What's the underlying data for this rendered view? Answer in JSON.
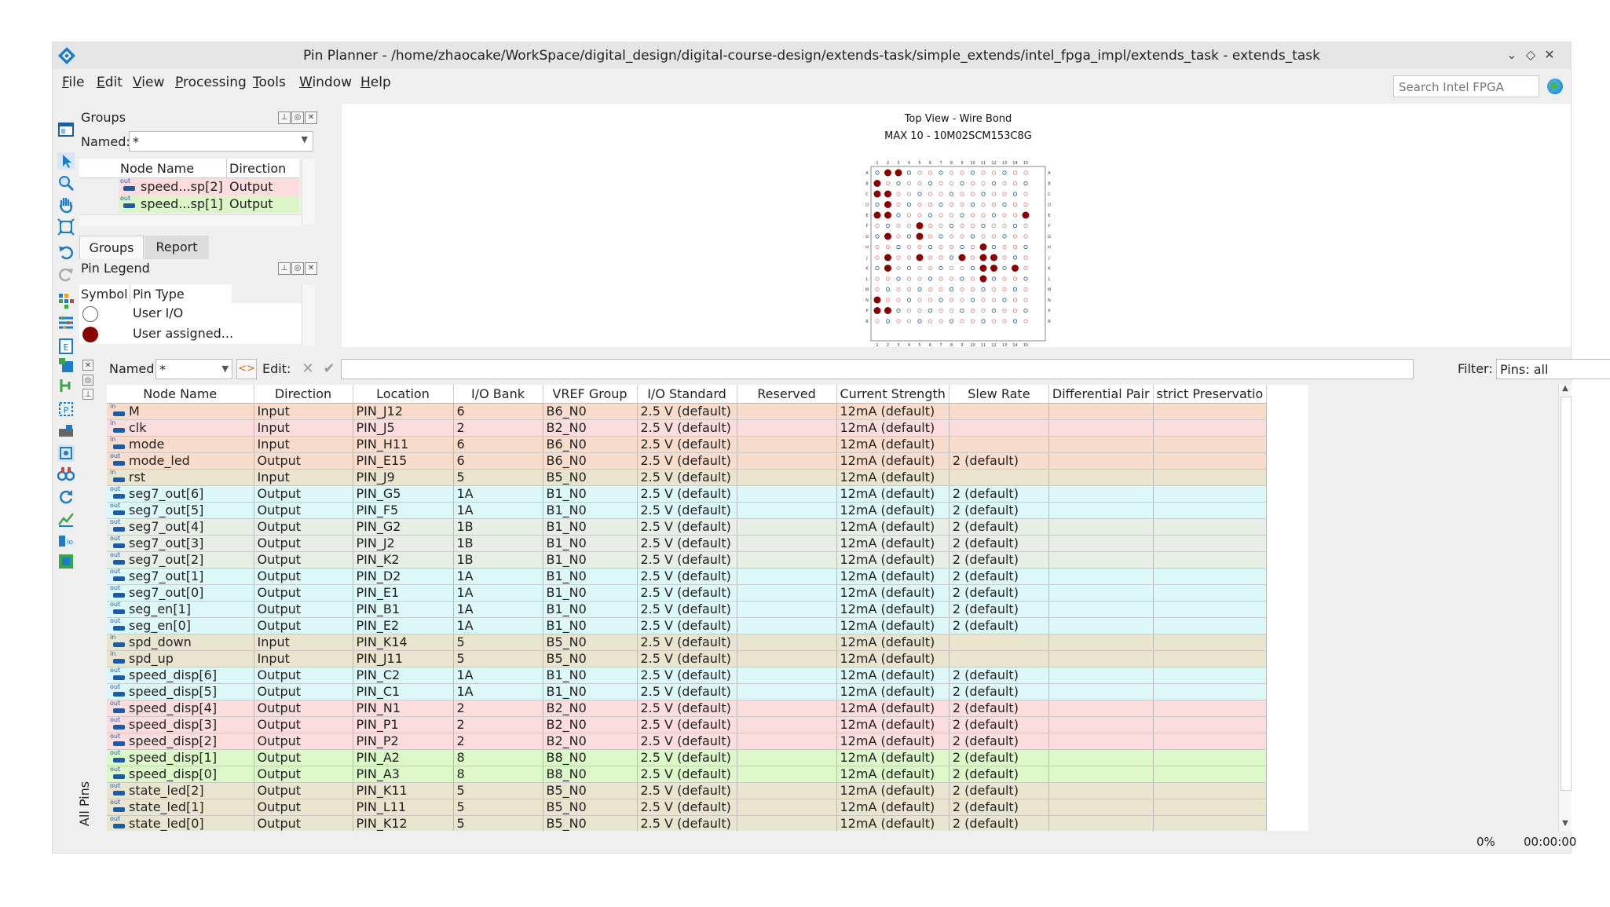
{
  "window": {
    "title": "Pin Planner - /home/zhaocake/WorkSpace/digital_design/digital-course-design/extends-task/simple_extends/intel_fpga_impl/extends_task - extends_task",
    "controls": [
      "⌄",
      "◇",
      "✕"
    ]
  },
  "menu": {
    "items": [
      {
        "label": "File",
        "key": "F",
        "rest": "ile"
      },
      {
        "label": "Edit",
        "key": "E",
        "rest": "dit"
      },
      {
        "label": "View",
        "key": "V",
        "rest": "iew"
      },
      {
        "label": "Processing",
        "key": "P",
        "rest": "rocessing"
      },
      {
        "label": "Tools",
        "key": "T",
        "rest": "ools"
      },
      {
        "label": "Window",
        "key": "W",
        "rest": "indow"
      },
      {
        "label": "Help",
        "key": "H",
        "rest": "elp"
      }
    ]
  },
  "search": {
    "placeholder": "Search Intel FPGA"
  },
  "groups_panel": {
    "title": "Groups",
    "named_label": "Named:",
    "named_value": "*",
    "columns": [
      "Node Name",
      "Direction"
    ],
    "rows": [
      {
        "name": "speed...sp[2]",
        "direction": "Output",
        "color": "#fcdcdc"
      },
      {
        "name": "speed...sp[1]",
        "direction": "Output",
        "color": "#dcf5c8"
      }
    ],
    "tabs": [
      "Groups",
      "Report"
    ]
  },
  "legend_panel": {
    "title": "Pin Legend",
    "columns": [
      "Symbol",
      "Pin Type"
    ],
    "rows": [
      {
        "symbol": "open-circle",
        "label": "User I/O"
      },
      {
        "symbol": "filled-circle",
        "label": "User assigned..."
      }
    ]
  },
  "package_view": {
    "title": "Top View - Wire Bond",
    "subtitle": "MAX 10 - 10M02SCM153C8G",
    "col_labels": [
      "1",
      "2",
      "3",
      "4",
      "5",
      "6",
      "7",
      "8",
      "9",
      "10",
      "11",
      "12",
      "13",
      "14",
      "15"
    ],
    "row_labels": [
      "A",
      "B",
      "C",
      "D",
      "E",
      "F",
      "G",
      "H",
      "J",
      "K",
      "L",
      "M",
      "N",
      "P",
      "R"
    ]
  },
  "filter_bar": {
    "named_label": "Named:",
    "named_value": "*",
    "edit_label": "Edit:",
    "filter_label": "Filter:",
    "filter_value": "Pins: all"
  },
  "side_tab": {
    "label": "All Pins"
  },
  "table": {
    "columns": [
      "Node Name",
      "Direction",
      "Location",
      "I/O Bank",
      "VREF Group",
      "I/O Standard",
      "Reserved",
      "Current Strength",
      "Slew Rate",
      "Differential Pair",
      "strict Preservatio"
    ],
    "rows": [
      {
        "dir_icon": "in",
        "name": "M",
        "direction": "Input",
        "location": "PIN_J12",
        "bank": "6",
        "vref": "B6_N0",
        "standard": "2.5 V (default)",
        "reserved": "",
        "strength": "12mA (default)",
        "slew": "",
        "diff": "",
        "strict": "",
        "color": "#f7dccb"
      },
      {
        "dir_icon": "in",
        "name": "clk",
        "direction": "Input",
        "location": "PIN_J5",
        "bank": "2",
        "vref": "B2_N0",
        "standard": "2.5 V (default)",
        "reserved": "",
        "strength": "12mA (default)",
        "slew": "",
        "diff": "",
        "strict": "",
        "color": "#fcdddd"
      },
      {
        "dir_icon": "in",
        "name": "mode",
        "direction": "Input",
        "location": "PIN_H11",
        "bank": "6",
        "vref": "B6_N0",
        "standard": "2.5 V (default)",
        "reserved": "",
        "strength": "12mA (default)",
        "slew": "",
        "diff": "",
        "strict": "",
        "color": "#f7dccb"
      },
      {
        "dir_icon": "out",
        "name": "mode_led",
        "direction": "Output",
        "location": "PIN_E15",
        "bank": "6",
        "vref": "B6_N0",
        "standard": "2.5 V (default)",
        "reserved": "",
        "strength": "12mA (default)",
        "slew": "2 (default)",
        "diff": "",
        "strict": "",
        "color": "#f7dccb"
      },
      {
        "dir_icon": "in",
        "name": "rst",
        "direction": "Input",
        "location": "PIN_J9",
        "bank": "5",
        "vref": "B5_N0",
        "standard": "2.5 V (default)",
        "reserved": "",
        "strength": "12mA (default)",
        "slew": "",
        "diff": "",
        "strict": "",
        "color": "#e8e4cd"
      },
      {
        "dir_icon": "out",
        "name": "seg7_out[6]",
        "direction": "Output",
        "location": "PIN_G5",
        "bank": "1A",
        "vref": "B1_N0",
        "standard": "2.5 V (default)",
        "reserved": "",
        "strength": "12mA (default)",
        "slew": "2 (default)",
        "diff": "",
        "strict": "",
        "color": "#dcf7f7"
      },
      {
        "dir_icon": "out",
        "name": "seg7_out[5]",
        "direction": "Output",
        "location": "PIN_F5",
        "bank": "1A",
        "vref": "B1_N0",
        "standard": "2.5 V (default)",
        "reserved": "",
        "strength": "12mA (default)",
        "slew": "2 (default)",
        "diff": "",
        "strict": "",
        "color": "#dcf7f7"
      },
      {
        "dir_icon": "out",
        "name": "seg7_out[4]",
        "direction": "Output",
        "location": "PIN_G2",
        "bank": "1B",
        "vref": "B1_N0",
        "standard": "2.5 V (default)",
        "reserved": "",
        "strength": "12mA (default)",
        "slew": "2 (default)",
        "diff": "",
        "strict": "",
        "color": "#e6eee6"
      },
      {
        "dir_icon": "out",
        "name": "seg7_out[3]",
        "direction": "Output",
        "location": "PIN_J2",
        "bank": "1B",
        "vref": "B1_N0",
        "standard": "2.5 V (default)",
        "reserved": "",
        "strength": "12mA (default)",
        "slew": "2 (default)",
        "diff": "",
        "strict": "",
        "color": "#e6eee6"
      },
      {
        "dir_icon": "out",
        "name": "seg7_out[2]",
        "direction": "Output",
        "location": "PIN_K2",
        "bank": "1B",
        "vref": "B1_N0",
        "standard": "2.5 V (default)",
        "reserved": "",
        "strength": "12mA (default)",
        "slew": "2 (default)",
        "diff": "",
        "strict": "",
        "color": "#e6eee6"
      },
      {
        "dir_icon": "out",
        "name": "seg7_out[1]",
        "direction": "Output",
        "location": "PIN_D2",
        "bank": "1A",
        "vref": "B1_N0",
        "standard": "2.5 V (default)",
        "reserved": "",
        "strength": "12mA (default)",
        "slew": "2 (default)",
        "diff": "",
        "strict": "",
        "color": "#dcf7f7"
      },
      {
        "dir_icon": "out",
        "name": "seg7_out[0]",
        "direction": "Output",
        "location": "PIN_E1",
        "bank": "1A",
        "vref": "B1_N0",
        "standard": "2.5 V (default)",
        "reserved": "",
        "strength": "12mA (default)",
        "slew": "2 (default)",
        "diff": "",
        "strict": "",
        "color": "#dcf7f7"
      },
      {
        "dir_icon": "out",
        "name": "seg_en[1]",
        "direction": "Output",
        "location": "PIN_B1",
        "bank": "1A",
        "vref": "B1_N0",
        "standard": "2.5 V (default)",
        "reserved": "",
        "strength": "12mA (default)",
        "slew": "2 (default)",
        "diff": "",
        "strict": "",
        "color": "#dcf7f7"
      },
      {
        "dir_icon": "out",
        "name": "seg_en[0]",
        "direction": "Output",
        "location": "PIN_E2",
        "bank": "1A",
        "vref": "B1_N0",
        "standard": "2.5 V (default)",
        "reserved": "",
        "strength": "12mA (default)",
        "slew": "2 (default)",
        "diff": "",
        "strict": "",
        "color": "#dcf7f7"
      },
      {
        "dir_icon": "in",
        "name": "spd_down",
        "direction": "Input",
        "location": "PIN_K14",
        "bank": "5",
        "vref": "B5_N0",
        "standard": "2.5 V (default)",
        "reserved": "",
        "strength": "12mA (default)",
        "slew": "",
        "diff": "",
        "strict": "",
        "color": "#e8e4cd"
      },
      {
        "dir_icon": "in",
        "name": "spd_up",
        "direction": "Input",
        "location": "PIN_J11",
        "bank": "5",
        "vref": "B5_N0",
        "standard": "2.5 V (default)",
        "reserved": "",
        "strength": "12mA (default)",
        "slew": "",
        "diff": "",
        "strict": "",
        "color": "#e8e4cd"
      },
      {
        "dir_icon": "out",
        "name": "speed_disp[6]",
        "direction": "Output",
        "location": "PIN_C2",
        "bank": "1A",
        "vref": "B1_N0",
        "standard": "2.5 V (default)",
        "reserved": "",
        "strength": "12mA (default)",
        "slew": "2 (default)",
        "diff": "",
        "strict": "",
        "color": "#dcf7f7"
      },
      {
        "dir_icon": "out",
        "name": "speed_disp[5]",
        "direction": "Output",
        "location": "PIN_C1",
        "bank": "1A",
        "vref": "B1_N0",
        "standard": "2.5 V (default)",
        "reserved": "",
        "strength": "12mA (default)",
        "slew": "2 (default)",
        "diff": "",
        "strict": "",
        "color": "#dcf7f7"
      },
      {
        "dir_icon": "out",
        "name": "speed_disp[4]",
        "direction": "Output",
        "location": "PIN_N1",
        "bank": "2",
        "vref": "B2_N0",
        "standard": "2.5 V (default)",
        "reserved": "",
        "strength": "12mA (default)",
        "slew": "2 (default)",
        "diff": "",
        "strict": "",
        "color": "#fcdddd"
      },
      {
        "dir_icon": "out",
        "name": "speed_disp[3]",
        "direction": "Output",
        "location": "PIN_P1",
        "bank": "2",
        "vref": "B2_N0",
        "standard": "2.5 V (default)",
        "reserved": "",
        "strength": "12mA (default)",
        "slew": "2 (default)",
        "diff": "",
        "strict": "",
        "color": "#fcdddd"
      },
      {
        "dir_icon": "out",
        "name": "speed_disp[2]",
        "direction": "Output",
        "location": "PIN_P2",
        "bank": "2",
        "vref": "B2_N0",
        "standard": "2.5 V (default)",
        "reserved": "",
        "strength": "12mA (default)",
        "slew": "2 (default)",
        "diff": "",
        "strict": "",
        "color": "#fcdddd"
      },
      {
        "dir_icon": "out",
        "name": "speed_disp[1]",
        "direction": "Output",
        "location": "PIN_A2",
        "bank": "8",
        "vref": "B8_N0",
        "standard": "2.5 V (default)",
        "reserved": "",
        "strength": "12mA (default)",
        "slew": "2 (default)",
        "diff": "",
        "strict": "",
        "color": "#dcf7c8"
      },
      {
        "dir_icon": "out",
        "name": "speed_disp[0]",
        "direction": "Output",
        "location": "PIN_A3",
        "bank": "8",
        "vref": "B8_N0",
        "standard": "2.5 V (default)",
        "reserved": "",
        "strength": "12mA (default)",
        "slew": "2 (default)",
        "diff": "",
        "strict": "",
        "color": "#dcf7c8"
      },
      {
        "dir_icon": "out",
        "name": "state_led[2]",
        "direction": "Output",
        "location": "PIN_K11",
        "bank": "5",
        "vref": "B5_N0",
        "standard": "2.5 V (default)",
        "reserved": "",
        "strength": "12mA (default)",
        "slew": "2 (default)",
        "diff": "",
        "strict": "",
        "color": "#e8e4cd"
      },
      {
        "dir_icon": "out",
        "name": "state_led[1]",
        "direction": "Output",
        "location": "PIN_L11",
        "bank": "5",
        "vref": "B5_N0",
        "standard": "2.5 V (default)",
        "reserved": "",
        "strength": "12mA (default)",
        "slew": "2 (default)",
        "diff": "",
        "strict": "",
        "color": "#e8e4cd"
      },
      {
        "dir_icon": "out",
        "name": "state_led[0]",
        "direction": "Output",
        "location": "PIN_K12",
        "bank": "5",
        "vref": "B5_N0",
        "standard": "2.5 V (default)",
        "reserved": "",
        "strength": "12mA (default)",
        "slew": "2 (default)",
        "diff": "",
        "strict": "",
        "color": "#e8e4cd"
      }
    ]
  },
  "status": {
    "progress": "0%",
    "elapsed": "00:00:00"
  },
  "colors": {
    "accent": "#1b7cc7",
    "pin_assigned": "#8b0000",
    "pin_io": "#1d5ca3"
  }
}
